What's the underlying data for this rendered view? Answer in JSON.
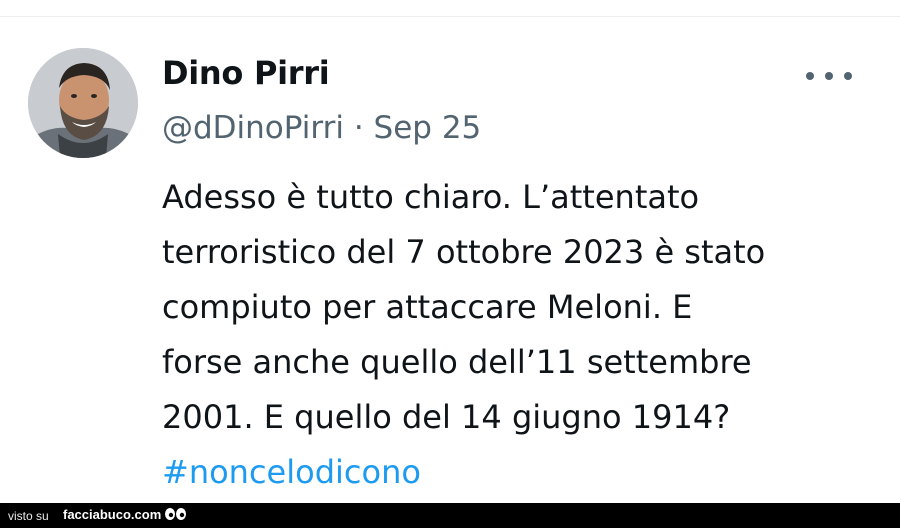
{
  "tweet": {
    "display_name": "Dino Pirri",
    "handle": "@dDinoPirri",
    "separator": "·",
    "date": "Sep 25",
    "body_lines": [
      "Adesso è tutto chiaro. L’attentato",
      "terroristico del 7 ottobre 2023 è stato",
      "compiuto per attaccare Meloni. E",
      "forse anche quello dell’11 settembre",
      "2001. E quello del 14 giugno 1914?"
    ],
    "hashtag": "#noncelodicono",
    "more_icon": "more-horizontal-icon"
  },
  "footer": {
    "visto_label": "visto su",
    "brand": "facciabuco.com"
  },
  "colors": {
    "text": "#0f1419",
    "secondary": "#536471",
    "link": "#1d9bf0"
  }
}
